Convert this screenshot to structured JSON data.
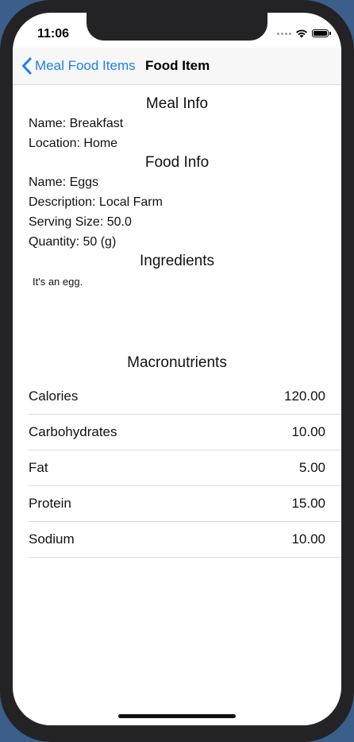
{
  "status_bar": {
    "time": "11:06"
  },
  "nav": {
    "back_label": "Meal Food Items",
    "title": "Food Item",
    "accent_color": "#1a7ff6"
  },
  "meal_info": {
    "heading": "Meal Info",
    "name": "Name: Breakfast",
    "location": "Location: Home"
  },
  "food_info": {
    "heading": "Food Info",
    "name": "Name: Eggs",
    "description": "Description: Local Farm",
    "serving_size": "Serving Size: 50.0",
    "quantity": "Quantity: 50 (g)"
  },
  "ingredients": {
    "heading": "Ingredients",
    "text": "It's an egg."
  },
  "macronutrients": {
    "heading": "Macronutrients",
    "rows": [
      {
        "label": "Calories",
        "value": "120.00"
      },
      {
        "label": "Carbohydrates",
        "value": "10.00"
      },
      {
        "label": "Fat",
        "value": "5.00"
      },
      {
        "label": "Protein",
        "value": "15.00"
      },
      {
        "label": "Sodium",
        "value": "10.00"
      }
    ]
  }
}
